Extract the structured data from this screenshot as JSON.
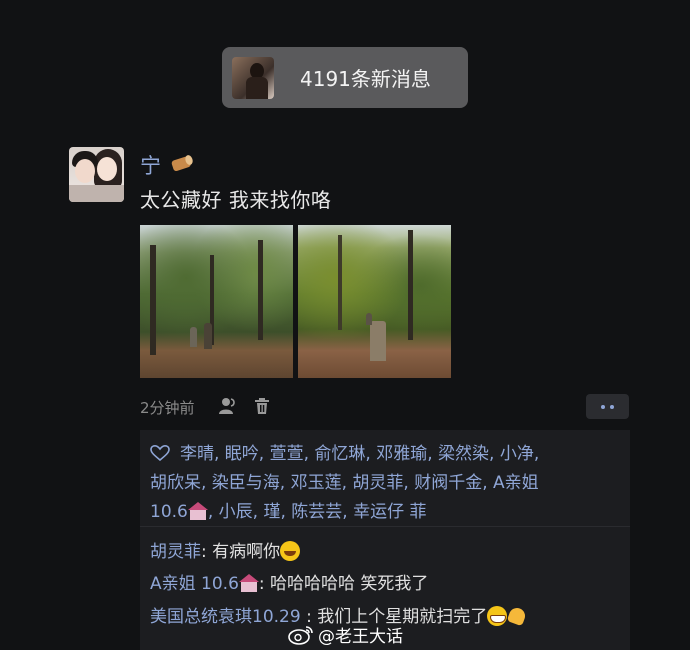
{
  "new_messages": {
    "label": "4191条新消息"
  },
  "post": {
    "sender": "宁",
    "text": "太公藏好 我来找你咯",
    "time": "2分钟前"
  },
  "likes": {
    "line1": "李晴, 眠吟, 萱萱, 俞忆琳, 邓雅瑜, 梁然染, 小净,",
    "line2": "胡欣呆, 染臣与海, 邓玉莲, 胡灵菲, 财阀千金, A亲姐",
    "line3a": "10.6",
    "line3b": ", 小辰, 瑾, 陈芸芸, 幸运仔 菲"
  },
  "comments": [
    {
      "name": "胡灵菲",
      "sep": ": ",
      "text": "有病啊你"
    },
    {
      "name": "A亲姐  10.6",
      "sep": ": ",
      "text": "哈哈哈哈哈 笑死我了"
    },
    {
      "name": "美国总统袁琪10.29",
      "sep": " : ",
      "text": "我们上个星期就扫完了"
    }
  ],
  "watermark": "@老王大话",
  "colors": {
    "background": "#111214",
    "name_blue": "#8fa6d6",
    "pill": "#5a5a5c"
  },
  "icons": [
    "heart-icon",
    "person-icon",
    "trash-icon",
    "wood-icon",
    "weibo-icon"
  ]
}
